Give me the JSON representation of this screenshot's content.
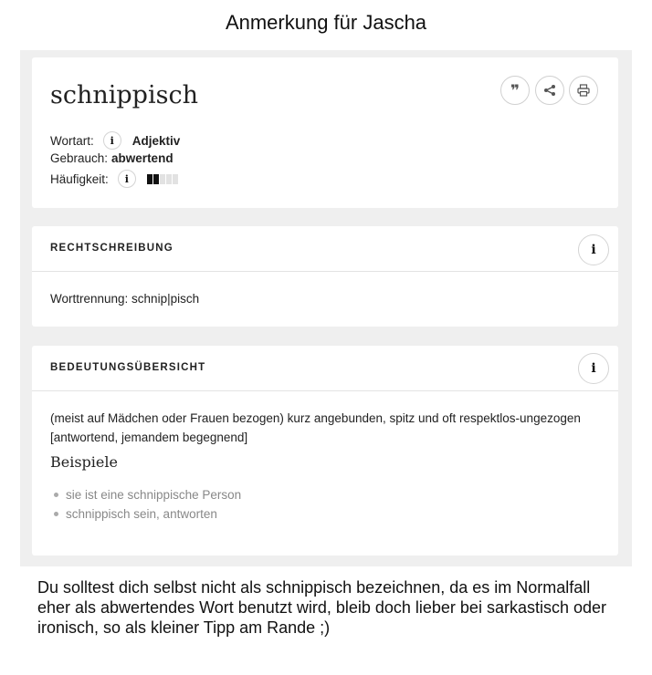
{
  "heading": "Anmerkung für Jascha",
  "entry": {
    "word": "schnippisch",
    "tools": [
      {
        "icon": "quote-icon",
        "glyph": "❞"
      },
      {
        "icon": "share-icon",
        "glyph": "share"
      },
      {
        "icon": "print-icon",
        "glyph": "print"
      }
    ],
    "wortart_label": "Wortart:",
    "wortart_value": "Adjektiv",
    "gebrauch_label": "Gebrauch:",
    "gebrauch_value": "abwertend",
    "haeufigkeit_label": "Häufigkeit:",
    "haeufigkeit_level": 2,
    "haeufigkeit_max": 5,
    "info_glyph": "i"
  },
  "rechtschreibung": {
    "title": "RECHTSCHREIBUNG",
    "worttrennung": "Worttrennung: schnip|pisch"
  },
  "bedeutung": {
    "title": "BEDEUTUNGSÜBERSICHT",
    "meaning": "(meist auf Mädchen oder Frauen bezogen) kurz angebunden, spitz und oft respektlos-ungezogen [antwortend, jemandem begegnend]",
    "examples_title": "Beispiele",
    "examples": [
      "sie ist eine schnippische Person",
      "schnippisch sein, antworten"
    ]
  },
  "note": "Du solltest dich selbst nicht als schnippisch bezeichnen, da es im Normalfall eher als abwertendes Wort benutzt wird, bleib doch lieber bei sarkastisch oder ironisch, so als kleiner Tipp am Rande ;)"
}
